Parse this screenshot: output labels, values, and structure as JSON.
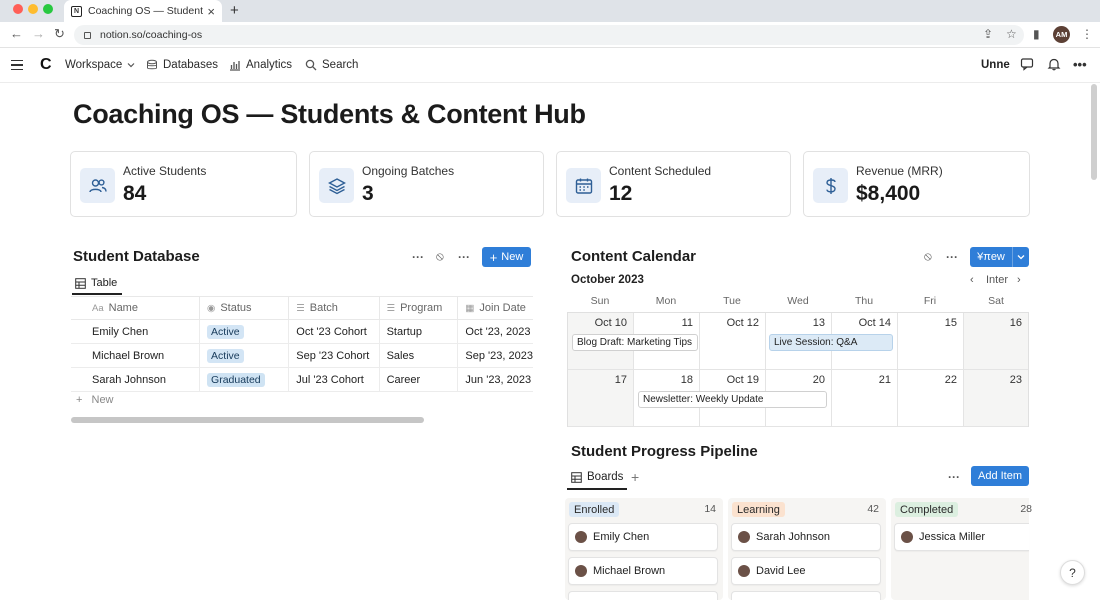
{
  "browser": {
    "tab_title": "Coaching OS — Students &",
    "favicon_letter": "N",
    "url": "notion.so/coaching-os",
    "avatar": "AM"
  },
  "appbar": {
    "brand": "C",
    "workspace": "Workspace",
    "databases": "Databases",
    "analytics": "Analytics",
    "search": "Search",
    "user": "Unne"
  },
  "page": {
    "title": "Coaching OS — Students & Content Hub"
  },
  "stats": [
    {
      "label": "Active Students",
      "value": "84",
      "icon": "users-icon"
    },
    {
      "label": "Ongoing Batches",
      "value": "3",
      "icon": "layers-icon"
    },
    {
      "label": "Content Scheduled",
      "value": "12",
      "icon": "calendar-icon"
    },
    {
      "label": "Revenue (MRR)",
      "value": "$8,400",
      "icon": "dollar-icon"
    }
  ],
  "student_db": {
    "title": "Student Database",
    "new_label": "New",
    "view_tab": "Table",
    "columns": [
      "Name",
      "Status",
      "Batch",
      "Program",
      "Join Date"
    ],
    "rows": [
      {
        "name": "Emily Chen",
        "status": "Active",
        "batch": "Oct '23 Cohort",
        "program": "Startup",
        "join": "Oct '23, 2023"
      },
      {
        "name": "Michael Brown",
        "status": "Active",
        "batch": "Sep '23 Cohort",
        "program": "Sales",
        "join": "Sep '23, 2023"
      },
      {
        "name": "Sarah Johnson",
        "status": "Graduated",
        "batch": "Jul '23 Cohort",
        "program": "Career",
        "join": "Jun '23, 2023"
      }
    ],
    "add_row": "New"
  },
  "calendar": {
    "title": "Content Calendar",
    "new_label": "¥πew",
    "month": "October 2023",
    "nav_label": "Inter",
    "days": [
      "Sun",
      "Mon",
      "Tue",
      "Wed",
      "Thu",
      "Fri",
      "Sat"
    ],
    "week1": [
      "Oct 10",
      "11",
      "Oct 12",
      "13",
      "Oct 14",
      "15",
      "16"
    ],
    "week2": [
      "17",
      "18",
      "Oct 19",
      "20",
      "21",
      "22",
      "23"
    ],
    "events": {
      "blog": "Blog Draft: Marketing Tips",
      "live": "Live Session: Q&A",
      "newsletter": "Newsletter: Weekly Update"
    }
  },
  "pipeline": {
    "title": "Student Progress Pipeline",
    "view_tab": "Boards",
    "add_item": "Add Item",
    "columns": [
      {
        "name": "Enrolled",
        "count": "14",
        "color": "#dbe8f5",
        "cards": [
          "Emily Chen",
          "Michael Brown"
        ]
      },
      {
        "name": "Learning",
        "count": "42",
        "color": "#fbe2cf",
        "cards": [
          "Sarah Johnson",
          "David Lee"
        ]
      },
      {
        "name": "Completed",
        "count": "28",
        "color": "#dcefe0",
        "cards": [
          "Jessica Miller"
        ]
      }
    ]
  },
  "help": "?"
}
